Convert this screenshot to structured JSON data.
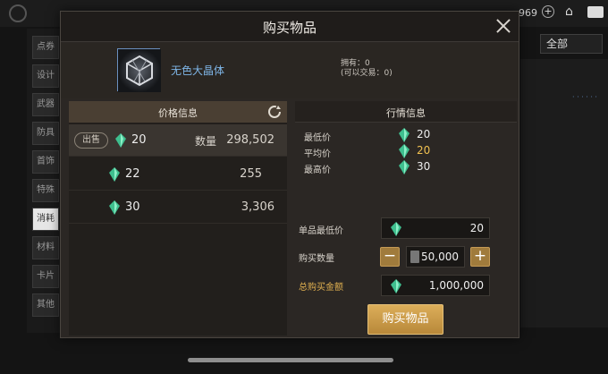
{
  "background": {
    "currency_fragment": "969",
    "filter_dropdown": "全部",
    "categories": [
      "点券",
      "设计",
      "武器",
      "防具",
      "首饰",
      "特殊",
      "消耗",
      "材料",
      "卡片",
      "其他"
    ],
    "active_category_index": 6
  },
  "modal": {
    "title": "购买物品",
    "item_name": "无色大晶体",
    "owned_line": "拥有：0",
    "tradable_line": "(可以交易：0)",
    "price_panel": {
      "header": "价格信息",
      "sell_label": "出售",
      "qty_label": "数量",
      "orders": [
        {
          "price": "20",
          "qty": "298,502"
        },
        {
          "price": "22",
          "qty": "255"
        },
        {
          "price": "30",
          "qty": "3,306"
        }
      ]
    },
    "market_panel": {
      "header": "行情信息",
      "stats": [
        {
          "label": "最低价",
          "value": "20"
        },
        {
          "label": "平均价",
          "value": "20"
        },
        {
          "label": "最高价",
          "value": "30"
        }
      ]
    },
    "form": {
      "unit_min_price_label": "单品最低价",
      "unit_min_price": "20",
      "buy_qty_label": "购买数量",
      "buy_qty": "50,000",
      "total_label": "总购买金额",
      "total": "1,000,000",
      "minus": "−",
      "plus": "+"
    },
    "buy_button": "购买物品"
  },
  "colors": {
    "accent_gold": "#b8883a",
    "gem_green": "#3fbf8f",
    "item_name_blue": "#7fb6e8",
    "avg_price_yellow": "#f0c050"
  }
}
